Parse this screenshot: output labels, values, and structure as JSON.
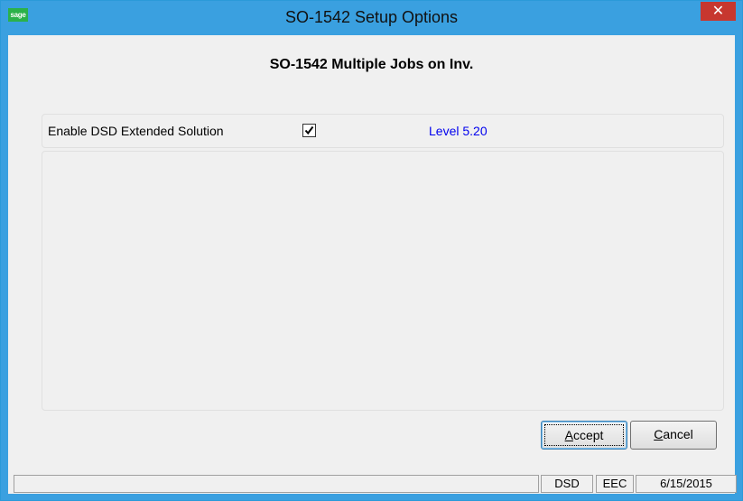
{
  "window": {
    "title": "SO-1542 Setup Options",
    "logo_text": "sage",
    "close_glyph": "✕"
  },
  "heading": "SO-1542 Multiple Jobs on Inv.",
  "option": {
    "label": "Enable DSD Extended Solution",
    "checked": true,
    "level": "Level  5.20"
  },
  "buttons": {
    "accept_mnemonic": "A",
    "accept_rest": "ccept",
    "cancel_mnemonic": "C",
    "cancel_rest": "ancel"
  },
  "status": {
    "main": "",
    "dsd": "DSD",
    "eec": "EEC",
    "date": "6/15/2015"
  },
  "colors": {
    "titlebar": "#3aa0e0",
    "close": "#c7372f",
    "level_text": "#0000ee"
  }
}
